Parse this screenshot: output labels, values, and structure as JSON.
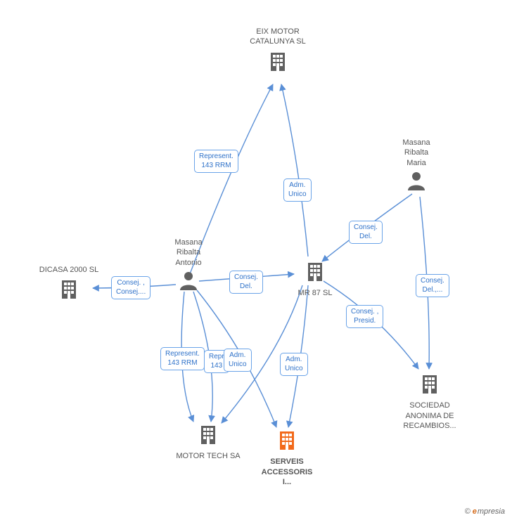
{
  "nodes": {
    "eix_motor": {
      "label": "EIX MOTOR\nCATALUNYA SL",
      "type": "company"
    },
    "masana_maria": {
      "label": "Masana\nRibalta\nMaria",
      "type": "person"
    },
    "masana_antonio": {
      "label": "Masana\nRibalta\nAntonio",
      "type": "person"
    },
    "dicasa": {
      "label": "DICASA 2000 SL",
      "type": "company"
    },
    "mr87": {
      "label": "MR 87 SL",
      "type": "company"
    },
    "sociedad": {
      "label": "SOCIEDAD\nANONIMA DE\nRECAMBIOS...",
      "type": "company"
    },
    "motor_tech": {
      "label": "MOTOR TECH SA",
      "type": "company"
    },
    "serveis": {
      "label": "SERVEIS\nACCESSORIS\nI...",
      "type": "company",
      "highlight": true
    }
  },
  "edges": [
    {
      "from": "masana_antonio",
      "to": "eix_motor",
      "label": "Represent.\n143 RRM"
    },
    {
      "from": "mr87",
      "to": "eix_motor",
      "label": "Adm.\nUnico"
    },
    {
      "from": "masana_antonio",
      "to": "mr87",
      "label": "Consej.\nDel."
    },
    {
      "from": "masana_antonio",
      "to": "dicasa",
      "label": "Consej. ,\nConsej...."
    },
    {
      "from": "masana_antonio",
      "to": "motor_tech",
      "label": "Represent.\n143 RRM"
    },
    {
      "from": "masana_antonio",
      "to": "motor_tech",
      "label": "Repr\n143"
    },
    {
      "from": "masana_antonio",
      "to": "serveis",
      "label": "Adm.\nUnico"
    },
    {
      "from": "mr87",
      "to": "motor_tech",
      "label": ""
    },
    {
      "from": "mr87",
      "to": "serveis",
      "label": "Adm.\nUnico"
    },
    {
      "from": "mr87",
      "to": "sociedad",
      "label": "Consej. ,\nPresid."
    },
    {
      "from": "masana_maria",
      "to": "mr87",
      "label": "Consej.\nDel."
    },
    {
      "from": "masana_maria",
      "to": "sociedad",
      "label": "Consej.\nDel.,..."
    }
  ],
  "footer": {
    "brand": "mpresia"
  },
  "colors": {
    "edge": "#5a8fd6",
    "label_border": "#6aa3e8",
    "label_text": "#2f72c9",
    "icon": "#606060",
    "highlight": "#f26a1b"
  }
}
